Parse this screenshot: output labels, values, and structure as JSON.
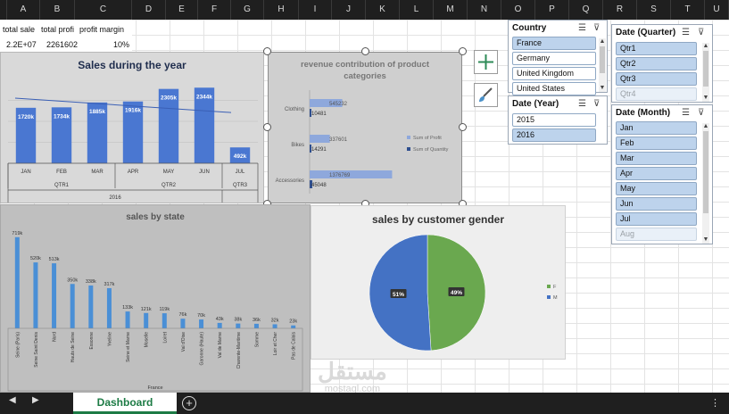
{
  "columns": [
    "A",
    "B",
    "C",
    "D",
    "E",
    "F",
    "G",
    "H",
    "I",
    "J",
    "K",
    "L",
    "M",
    "N",
    "O",
    "P",
    "Q",
    "R",
    "S",
    "T",
    "U"
  ],
  "summary": {
    "labels": [
      "total sale",
      "total profi",
      "profit margin"
    ],
    "values": [
      "2.2E+07",
      "2261602",
      "10%"
    ]
  },
  "sales_chart": {
    "title": "Sales during the year",
    "year": "2016",
    "chart_data": {
      "type": "bar",
      "title": "Sales during the year",
      "categories": [
        "JAN",
        "FEB",
        "MAR",
        "APR",
        "MAY",
        "JUN",
        "JUL"
      ],
      "quarters": [
        "QTR1",
        "QTR2",
        "QTR3"
      ],
      "values": [
        1720,
        1734,
        1885,
        1916,
        2305,
        2344,
        492
      ],
      "data_labels": [
        "1720k",
        "1734k",
        "1885k",
        "1916k",
        "2305k",
        "2344k",
        "492k"
      ],
      "ylim": [
        0,
        2600
      ],
      "trendline": true,
      "colors": {
        "bar": "#4a77d1",
        "trend": "#3a5fb5"
      }
    }
  },
  "revenue_chart": {
    "title": "revenue contribution of product categories",
    "legend": [
      "Sum of Profit",
      "Sum of Quantity"
    ],
    "chart_data": {
      "type": "bar",
      "orientation": "horizontal",
      "categories": [
        "Clothing",
        "Bikes",
        "Accessories"
      ],
      "series": [
        {
          "name": "Sum of Profit",
          "values": [
            545232,
            337601,
            1376769
          ],
          "labels": [
            "545232",
            "337601",
            "1376769"
          ]
        },
        {
          "name": "Sum of Quantity",
          "values": [
            10481,
            14291,
            45048
          ],
          "labels": [
            "10481",
            "14291",
            "45048"
          ]
        }
      ],
      "colors": {
        "profit": "#8ea8dc",
        "quantity": "#2f4f8f"
      }
    }
  },
  "state_chart": {
    "title": "sales by state",
    "axis_group": "France",
    "chart_data": {
      "type": "bar",
      "title": "sales by state",
      "categories": [
        "Seine (Paris)",
        "Seine Saint Denis",
        "Nord",
        "Hauts de Seine",
        "Essonne",
        "Yveline",
        "Seine et Marne",
        "Moselle",
        "Loiret",
        "Val d'Oise",
        "Garonne (Haute)",
        "Val de Marne",
        "Charente-Maritime",
        "Somme",
        "Loir et Cher",
        "Pas de Calais"
      ],
      "values": [
        719,
        520,
        513,
        350,
        338,
        317,
        133,
        121,
        119,
        76,
        70,
        43,
        38,
        36,
        32,
        23
      ],
      "data_labels": [
        "719k",
        "520k",
        "513k",
        "350k",
        "338k",
        "317k",
        "133k",
        "121k",
        "119k",
        "76k",
        "70k",
        "43k",
        "38k",
        "36k",
        "32k",
        "23k"
      ],
      "ylim": [
        0,
        760
      ],
      "colors": {
        "bar": "#4a8fd6"
      }
    }
  },
  "gender_chart": {
    "title": "sales by customer gender",
    "legend": [
      "F",
      "M"
    ],
    "chart_data": {
      "type": "pie",
      "title": "sales by customer gender",
      "categories": [
        "F",
        "M"
      ],
      "values": [
        49,
        51
      ],
      "data_labels": [
        "49%",
        "51%"
      ],
      "colors": {
        "F": "#6aa84f",
        "M": "#4472c4"
      }
    }
  },
  "slicers": {
    "country": {
      "title": "Country",
      "items": [
        {
          "label": "France",
          "state": "sel"
        },
        {
          "label": "Germany",
          "state": "un"
        },
        {
          "label": "United Kingdom",
          "state": "un"
        },
        {
          "label": "United States",
          "state": "un"
        }
      ]
    },
    "year": {
      "title": "Date (Year)",
      "items": [
        {
          "label": "2015",
          "state": "un"
        },
        {
          "label": "2016",
          "state": "sel"
        }
      ]
    },
    "quarter": {
      "title": "Date (Quarter)",
      "items": [
        {
          "label": "Qtr1",
          "state": "sel"
        },
        {
          "label": "Qtr2",
          "state": "sel"
        },
        {
          "label": "Qtr3",
          "state": "sel"
        },
        {
          "label": "Qtr4",
          "state": "dim"
        }
      ]
    },
    "month": {
      "title": "Date (Month)",
      "items": [
        {
          "label": "Jan",
          "state": "sel"
        },
        {
          "label": "Feb",
          "state": "sel"
        },
        {
          "label": "Mar",
          "state": "sel"
        },
        {
          "label": "Apr",
          "state": "sel"
        },
        {
          "label": "May",
          "state": "sel"
        },
        {
          "label": "Jun",
          "state": "sel"
        },
        {
          "label": "Jul",
          "state": "sel"
        },
        {
          "label": "Aug",
          "state": "dim"
        }
      ]
    }
  },
  "tabs": {
    "sheet": "Dashboard",
    "add": "+",
    "prev": "◀",
    "next": "▶"
  },
  "watermark": {
    "arabic": "مستقل",
    "latin": "mostaql.com"
  },
  "icons": [
    "plus-icon",
    "brush-icon",
    "multi-select-icon",
    "clear-filter-icon"
  ]
}
